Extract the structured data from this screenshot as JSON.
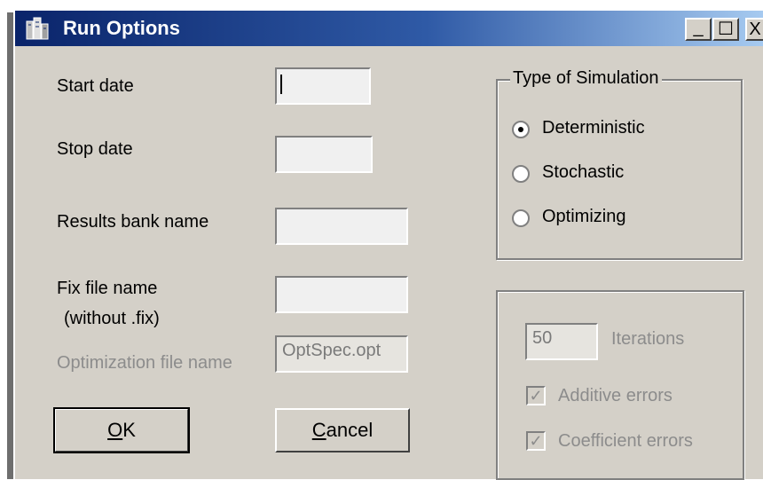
{
  "window": {
    "title": "Run Options",
    "minimize_glyph": "_",
    "maximize_glyph": "☐",
    "close_glyph": "X"
  },
  "form": {
    "start_date_label": "Start date",
    "start_date_value": "",
    "stop_date_label": "Stop date",
    "stop_date_value": "",
    "results_bank_label": "Results bank name",
    "results_bank_value": "",
    "fix_file_label": "Fix file name",
    "fix_file_sublabel": "(without .fix)",
    "fix_file_value": "",
    "optimization_file_label": "Optimization file name",
    "optimization_file_value": "OptSpec.opt"
  },
  "buttons": {
    "ok_mnemonic": "O",
    "ok_rest": "K",
    "cancel_mnemonic": "C",
    "cancel_rest": "ancel"
  },
  "simulation": {
    "group_title": "Type of Simulation",
    "options": [
      {
        "label": "Deterministic",
        "checked": true
      },
      {
        "label": "Stochastic",
        "checked": false
      },
      {
        "label": "Optimizing",
        "checked": false
      }
    ]
  },
  "stochastic": {
    "iterations_value": "50",
    "iterations_label": "Iterations",
    "additive_errors_label": "Additive errors",
    "additive_errors_checked": true,
    "coefficient_errors_label": "Coefficient errors",
    "coefficient_errors_checked": true,
    "check_glyph": "✓"
  },
  "icons": {
    "app": "run-options-app-icon",
    "minimize": "minimize-icon",
    "maximize": "maximize-icon",
    "close": "close-icon"
  }
}
